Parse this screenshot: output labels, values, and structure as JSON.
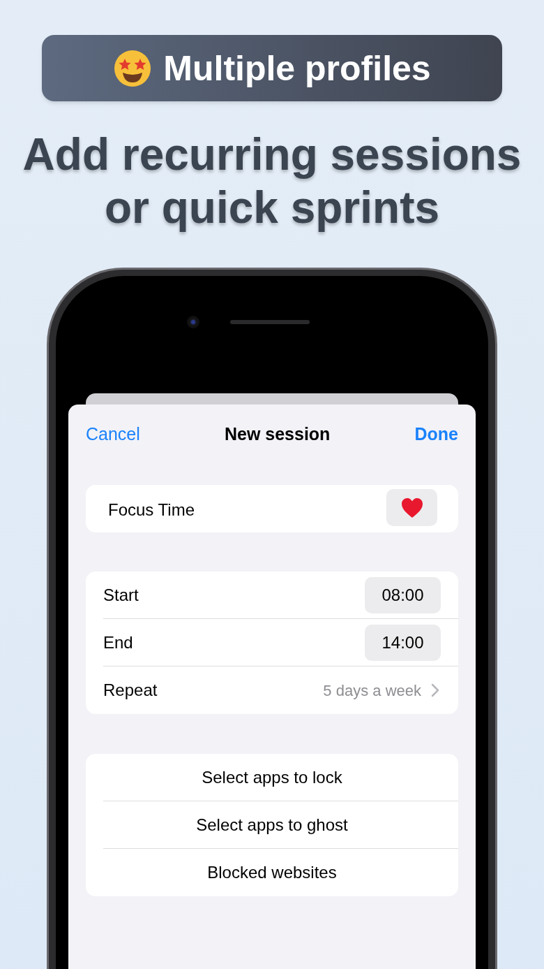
{
  "banner": {
    "title": "Multiple profiles"
  },
  "headline": "Add recurring sessions or quick sprints",
  "sheet": {
    "cancel": "Cancel",
    "title": "New session",
    "done": "Done",
    "name_field": {
      "value": "Focus Time"
    },
    "schedule": [
      {
        "kind": "time",
        "label": "Start",
        "value": "08:00"
      },
      {
        "kind": "time",
        "label": "End",
        "value": "14:00"
      },
      {
        "kind": "link",
        "label": "Repeat",
        "value": "5 days a week"
      }
    ],
    "actions": [
      "Select apps to lock",
      "Select apps to ghost",
      "Blocked websites"
    ]
  }
}
